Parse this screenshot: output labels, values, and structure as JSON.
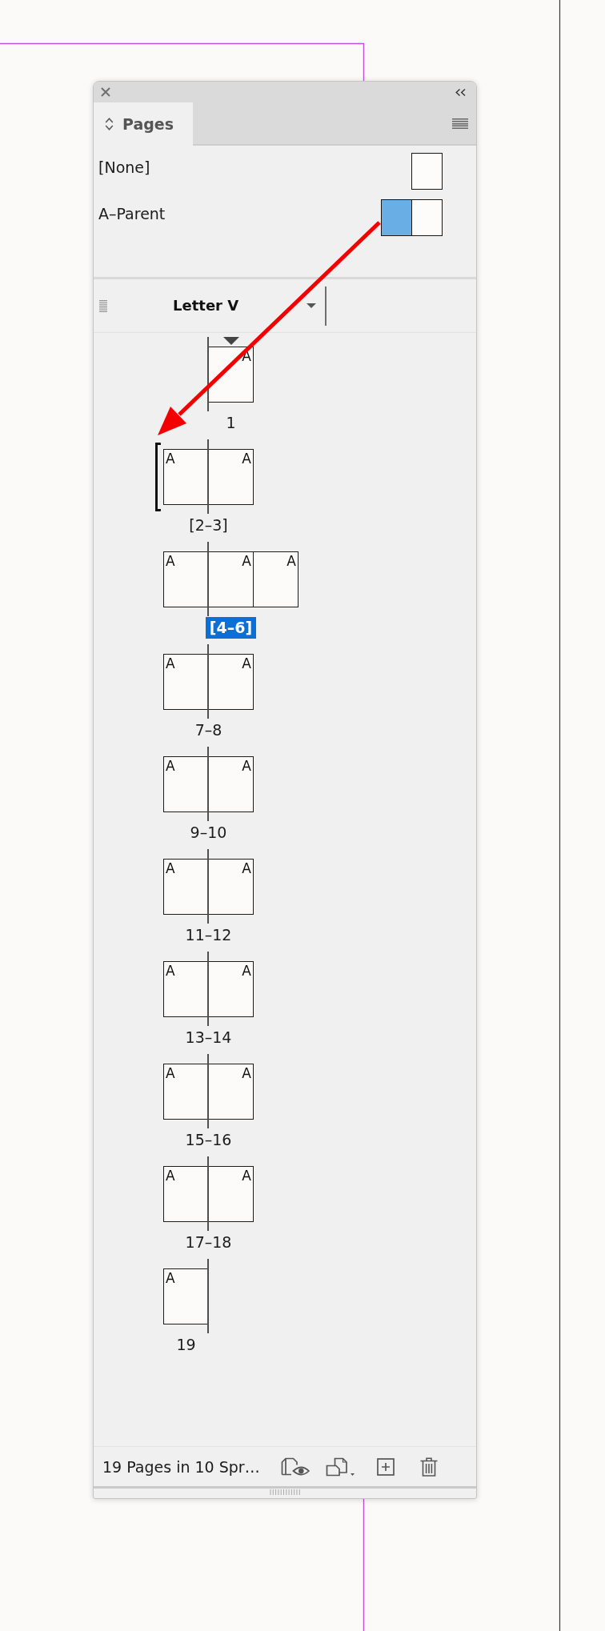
{
  "tabs": [
    {
      "label": "Pages",
      "selected": true
    }
  ],
  "parents": [
    {
      "name": "[None]",
      "pages": [
        {
          "selected": false
        }
      ]
    },
    {
      "name": "A–Parent",
      "pages": [
        {
          "selected": true
        },
        {
          "selected": false
        }
      ]
    }
  ],
  "page_size": {
    "label": "Letter V"
  },
  "spreads": [
    {
      "label": "1",
      "selected": false,
      "section_start": true,
      "drop_target": false,
      "pages": [
        {
          "kind": "right",
          "master": "A"
        }
      ]
    },
    {
      "label": "[2–3]",
      "selected": false,
      "section_start": false,
      "drop_target": true,
      "pages": [
        {
          "kind": "left",
          "master": "A"
        },
        {
          "kind": "right",
          "master": "A"
        }
      ]
    },
    {
      "label": "[4–6]",
      "selected": true,
      "section_start": false,
      "drop_target": false,
      "pages": [
        {
          "kind": "left",
          "master": "A"
        },
        {
          "kind": "right",
          "master": "A"
        },
        {
          "kind": "right",
          "master": "A"
        }
      ]
    },
    {
      "label": "7–8",
      "selected": false,
      "section_start": false,
      "drop_target": false,
      "pages": [
        {
          "kind": "left",
          "master": "A"
        },
        {
          "kind": "right",
          "master": "A"
        }
      ]
    },
    {
      "label": "9–10",
      "selected": false,
      "section_start": false,
      "drop_target": false,
      "pages": [
        {
          "kind": "left",
          "master": "A"
        },
        {
          "kind": "right",
          "master": "A"
        }
      ]
    },
    {
      "label": "11–12",
      "selected": false,
      "section_start": false,
      "drop_target": false,
      "pages": [
        {
          "kind": "left",
          "master": "A"
        },
        {
          "kind": "right",
          "master": "A"
        }
      ]
    },
    {
      "label": "13–14",
      "selected": false,
      "section_start": false,
      "drop_target": false,
      "pages": [
        {
          "kind": "left",
          "master": "A"
        },
        {
          "kind": "right",
          "master": "A"
        }
      ]
    },
    {
      "label": "15–16",
      "selected": false,
      "section_start": false,
      "drop_target": false,
      "pages": [
        {
          "kind": "left",
          "master": "A"
        },
        {
          "kind": "right",
          "master": "A"
        }
      ]
    },
    {
      "label": "17–18",
      "selected": false,
      "section_start": false,
      "drop_target": false,
      "pages": [
        {
          "kind": "left",
          "master": "A"
        },
        {
          "kind": "right",
          "master": "A"
        }
      ]
    },
    {
      "label": "19",
      "selected": false,
      "section_start": false,
      "drop_target": false,
      "pages": [
        {
          "kind": "left",
          "master": "A"
        }
      ]
    }
  ],
  "status_bar": {
    "text": "19 Pages in 10 Spr…"
  }
}
